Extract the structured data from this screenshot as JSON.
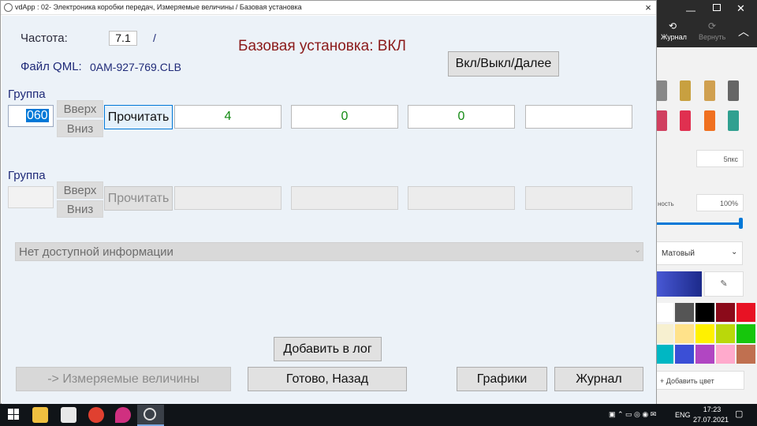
{
  "window": {
    "title": "vdApp : 02- Электроника коробки передач,  Измеряемые величины / Базовая установка",
    "close": "×"
  },
  "header": {
    "freq_label": "Частота:",
    "freq_value": "7.1",
    "freq_sep": "/",
    "status_text": "Базовая установка: ВКЛ",
    "status_color": "#8b1a1a",
    "qml_label": "Файл QML:",
    "qml_value": "0AM-927-769.CLB",
    "onoff_button": "Вкл/Выкл/Далее"
  },
  "group1": {
    "label": "Группа",
    "value": "060",
    "up": "Вверх",
    "down": "Вниз",
    "read": "Прочитать",
    "fields": [
      "4",
      "0",
      "0",
      ""
    ]
  },
  "group2": {
    "label": "Группа",
    "value": "",
    "up": "Вверх",
    "down": "Вниз",
    "read": "Прочитать",
    "fields": [
      "",
      "",
      "",
      ""
    ]
  },
  "info_select": {
    "value": "Нет доступной информации"
  },
  "buttons": {
    "add_log": "Добавить в лог",
    "measured": "-> Измеряемые величины",
    "done_back": "Готово, Назад",
    "graphs": "Графики",
    "journal": "Журнал"
  },
  "paint": {
    "journal": "Журнал",
    "redo": "Вернуть",
    "size": "5пкс",
    "opacity_label": "ность",
    "opacity": "100%",
    "texture": "Матовый",
    "add_color": "Добавить цвет",
    "accent": "#4a5ad8",
    "palette": [
      "#ffffff",
      "#555555",
      "#000000",
      "#8b0a1a",
      "#e81224",
      "#f7f0d0",
      "#ffe28a",
      "#fff100",
      "#bad80a",
      "#16c60c",
      "#00b7c3",
      "#3b4fd6",
      "#b146c2",
      "#ffaacc",
      "#c07050"
    ]
  },
  "taskbar": {
    "lang": "ENG",
    "time": "17:23",
    "date": "27.07.2021"
  }
}
